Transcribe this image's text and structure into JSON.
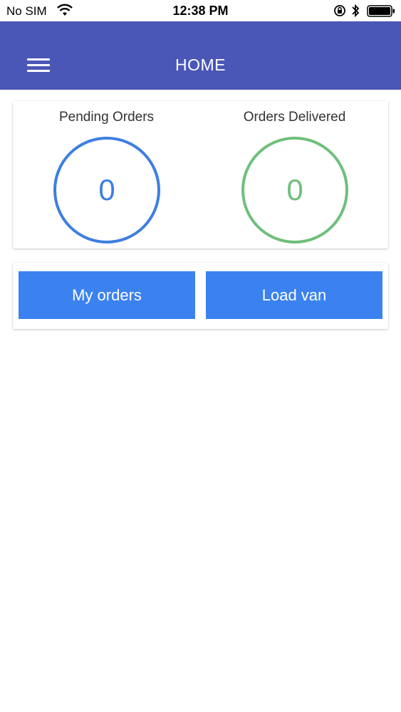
{
  "status_bar": {
    "carrier": "No SIM",
    "time": "12:38 PM"
  },
  "header": {
    "title": "HOME"
  },
  "stats": {
    "pending_label": "Pending Orders",
    "pending_count": "0",
    "delivered_label": "Orders Delivered",
    "delivered_count": "0"
  },
  "actions": {
    "my_orders_label": "My orders",
    "load_van_label": "Load van"
  },
  "colors": {
    "header_bg": "#4a57b6",
    "pending_ring": "#3d7fe0",
    "delivered_ring": "#6fbf7b",
    "button_bg": "#3b82f0"
  }
}
